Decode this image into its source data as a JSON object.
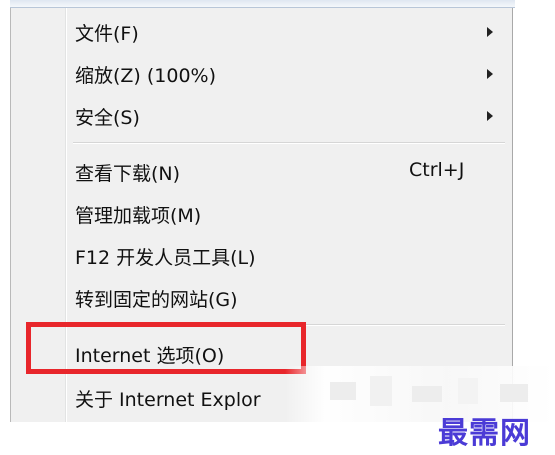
{
  "menu": {
    "items": [
      {
        "label": "文件(F)",
        "submenu": true
      },
      {
        "label": "缩放(Z) (100%)",
        "submenu": true
      },
      {
        "label": "安全(S)",
        "submenu": true
      },
      {
        "label": "查看下载(N)",
        "shortcut": "Ctrl+J"
      },
      {
        "label": "管理加载项(M)"
      },
      {
        "label": "F12 开发人员工具(L)"
      },
      {
        "label": "转到固定的网站(G)"
      },
      {
        "label": "Internet 选项(O)",
        "highlighted": true
      },
      {
        "label": "关于 Internet Explor"
      }
    ],
    "submenu_icon": "triangle-right-icon"
  },
  "annotation": {
    "highlight_color": "#e8262b"
  },
  "watermark": {
    "text": "最需网",
    "color": "#4b3bd6"
  }
}
